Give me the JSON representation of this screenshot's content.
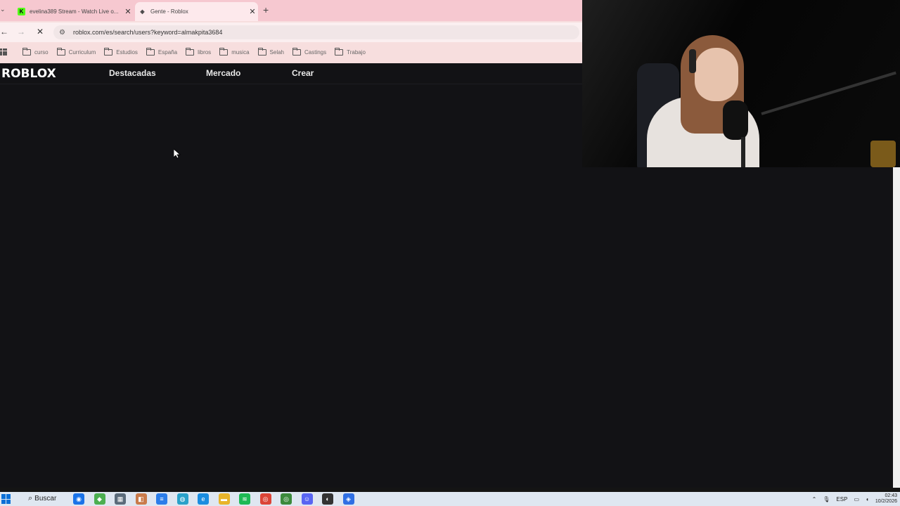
{
  "browser": {
    "tabs": [
      {
        "title": "evelina389 Stream - Watch Live o...",
        "favicon": "K",
        "active": false
      },
      {
        "title": "Gente - Roblox",
        "favicon": "◈",
        "active": true
      }
    ],
    "new_tab_label": "+",
    "url": "roblox.com/es/search/users?keyword=almakpita3684",
    "bookmarks": [
      "curso",
      "Curriculum",
      "Estudios",
      "España",
      "libros",
      "musica",
      "Selah",
      "Castings",
      "Trabajo"
    ]
  },
  "roblox": {
    "logo": "ROBLOX",
    "nav": [
      "Destacadas",
      "Mercado",
      "Crear"
    ]
  },
  "taskbar": {
    "search_label": "Buscar",
    "apps": [
      {
        "icon": "maps-icon",
        "color": "#1a73e8",
        "glyph": "◉"
      },
      {
        "icon": "app-icon",
        "color": "#4caf50",
        "glyph": "◆"
      },
      {
        "icon": "calculator-icon",
        "color": "#5b6b7a",
        "glyph": "▦"
      },
      {
        "icon": "store-icon",
        "color": "#c97b4b",
        "glyph": "◧"
      },
      {
        "icon": "notes-icon",
        "color": "#2b7de9",
        "glyph": "≡"
      },
      {
        "icon": "globe-icon",
        "color": "#2aa1c9",
        "glyph": "◍"
      },
      {
        "icon": "edge-icon",
        "color": "#1a8de0",
        "glyph": "e"
      },
      {
        "icon": "folder-icon",
        "color": "#e8b42a",
        "glyph": "▬"
      },
      {
        "icon": "spotify-icon",
        "color": "#1db954",
        "glyph": "≋"
      },
      {
        "icon": "chrome-icon",
        "color": "#db4437",
        "glyph": "◎"
      },
      {
        "icon": "chrome-profile-icon",
        "color": "#3c8a3c",
        "glyph": "◎"
      },
      {
        "icon": "discord-icon",
        "color": "#5865f2",
        "glyph": "☺"
      },
      {
        "icon": "obs-icon",
        "color": "#333333",
        "glyph": "◐"
      },
      {
        "icon": "roblox-studio-icon",
        "color": "#2f6fe4",
        "glyph": "◈"
      }
    ],
    "tray": {
      "language": "ESP",
      "time": "02:43",
      "date": "10/2/2026"
    }
  }
}
